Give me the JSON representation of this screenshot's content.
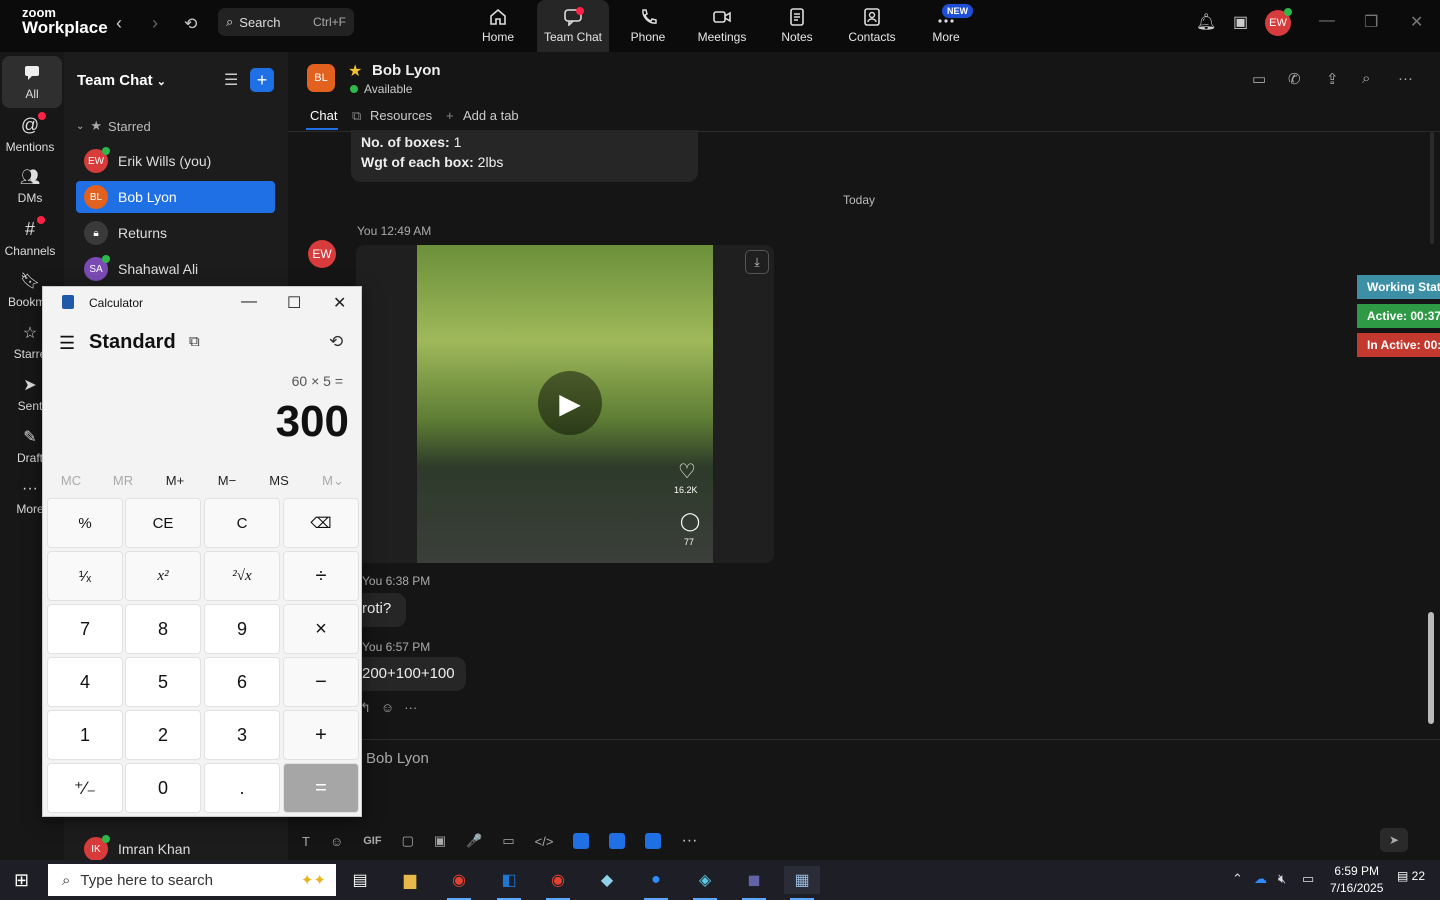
{
  "app": {
    "brand_line1": "zoom",
    "brand_line2": "Workplace"
  },
  "search": {
    "label": "Search",
    "shortcut": "Ctrl+F"
  },
  "topnav": [
    {
      "label": "Home",
      "icon": "home-icon"
    },
    {
      "label": "Team Chat",
      "icon": "chat-icon",
      "active": true
    },
    {
      "label": "Phone",
      "icon": "phone-icon"
    },
    {
      "label": "Meetings",
      "icon": "video-icon"
    },
    {
      "label": "Notes",
      "icon": "notes-icon"
    },
    {
      "label": "Contacts",
      "icon": "contacts-icon"
    },
    {
      "label": "More",
      "icon": "more-icon"
    }
  ],
  "new_badge": "NEW",
  "user_avatar": "EW",
  "leftrail": [
    {
      "label": "All",
      "active": true
    },
    {
      "label": "Mentions"
    },
    {
      "label": "DMs"
    },
    {
      "label": "Channels"
    },
    {
      "label": "Bookma"
    },
    {
      "label": "Starre"
    },
    {
      "label": "Sent"
    },
    {
      "label": "Draft"
    },
    {
      "label": "More"
    }
  ],
  "sidepanel": {
    "title": "Team Chat",
    "section": "Starred",
    "contacts": [
      {
        "initials": "EW",
        "name": "Erik Wills (you)",
        "color": "#d83b3b"
      },
      {
        "initials": "BL",
        "name": "Bob Lyon",
        "color": "#e3611f",
        "active": true
      },
      {
        "initials": "",
        "name": "Returns",
        "color": "#444"
      },
      {
        "initials": "SA",
        "name": "Shahawal Ali",
        "color": "#7b4bb5"
      }
    ],
    "bottom_contact": {
      "initials": "IK",
      "name": "Imran Khan",
      "color": "#d83b3b"
    }
  },
  "chat": {
    "header": {
      "initials": "BL",
      "name": "Bob Lyon",
      "status": "Available"
    },
    "tabs": [
      "Chat",
      "Resources",
      "Add a tab"
    ],
    "prev_message": {
      "label1": "No. of boxes:",
      "value1": "1",
      "label2": "Wgt of each box:",
      "value2": "2lbs"
    },
    "day_separator": "Today",
    "messages": [
      {
        "meta": "You 12:49 AM",
        "type": "video",
        "likes": "16.2K",
        "comments": "77"
      },
      {
        "meta": "You 6:38 PM",
        "text": "roti?"
      },
      {
        "meta": "You 6:57 PM",
        "text": "200+100+100"
      }
    ],
    "sender_avatar": "EW",
    "compose_placeholder": "Bob Lyon",
    "toolbar": [
      "T",
      "☺",
      "GIF",
      "▢",
      "▣",
      "🎤",
      "▭",
      "</>"
    ]
  },
  "working_status": [
    {
      "text": "Working Stat",
      "color": "#3d8fa6"
    },
    {
      "text": "Active: 00:37",
      "color": "#2e9a46"
    },
    {
      "text": "In Active: 00:",
      "color": "#c4392f"
    }
  ],
  "calculator": {
    "title": "Calculator",
    "mode": "Standard",
    "expression": "60 × 5 =",
    "result": "300",
    "memory": [
      {
        "label": "MC",
        "disabled": true
      },
      {
        "label": "MR",
        "disabled": true
      },
      {
        "label": "M+"
      },
      {
        "label": "M−"
      },
      {
        "label": "MS"
      },
      {
        "label": "M⌄",
        "disabled": true
      }
    ],
    "keys": [
      [
        "%",
        "CE",
        "C",
        "⌫"
      ],
      [
        "¹⁄ₓ",
        "x²",
        "²√x",
        "÷"
      ],
      [
        "7",
        "8",
        "9",
        "×"
      ],
      [
        "4",
        "5",
        "6",
        "−"
      ],
      [
        "1",
        "2",
        "3",
        "+"
      ],
      [
        "⁺∕₋",
        "0",
        ".",
        "="
      ]
    ]
  },
  "taskbar": {
    "search_placeholder": "Type here to search",
    "time": "6:59 PM",
    "date": "7/16/2025",
    "notifications": "22"
  }
}
